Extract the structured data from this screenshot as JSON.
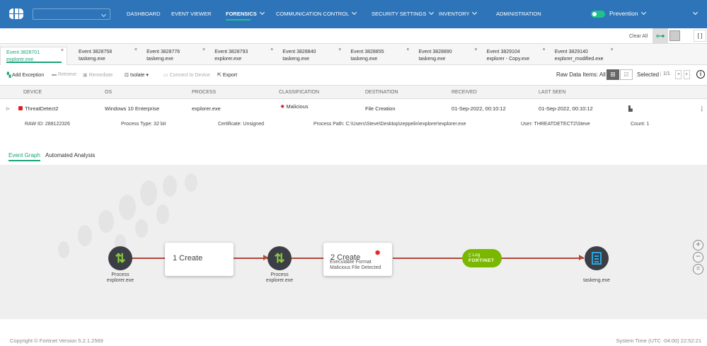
{
  "nav": {
    "items": [
      {
        "label": "DASHBOARD"
      },
      {
        "label": "EVENT VIEWER"
      },
      {
        "label": "FORENSICS",
        "active": true
      },
      {
        "label": "COMMUNICATION CONTROL"
      },
      {
        "label": "SECURITY SETTINGS"
      },
      {
        "label": "INVENTORY"
      },
      {
        "label": "ADMINISTRATION"
      }
    ],
    "mode": "Prevention",
    "mode_on": true,
    "org_select": ""
  },
  "toolbar": {
    "clear_all": "Clear All"
  },
  "tabs": [
    {
      "title": "Event 3828701",
      "sub": "explorer.exe",
      "active": true
    },
    {
      "title": "Event 3828758",
      "sub": "taskeng.exe"
    },
    {
      "title": "Event 3828776",
      "sub": "taskeng.exe"
    },
    {
      "title": "Event 3828793",
      "sub": "explorer.exe"
    },
    {
      "title": "Event 3828840",
      "sub": "taskeng.exe"
    },
    {
      "title": "Event 3828855",
      "sub": "taskeng.exe"
    },
    {
      "title": "Event 3828890",
      "sub": "taskeng.exe"
    },
    {
      "title": "Event 3829104",
      "sub": "explorer - Copy.exe"
    },
    {
      "title": "Event 3829140",
      "sub": "explorer_modified.exe"
    }
  ],
  "actions": {
    "add_exception": "Add Exception",
    "retrieve": "Retrieve",
    "remediate": "Remediate",
    "isolate": "Isolate",
    "connect": "Connect to Device",
    "export": "Export",
    "raw_items": "Raw Data Items: All",
    "selected": "Selected",
    "page": "1/1"
  },
  "table": {
    "headers": [
      "DEVICE",
      "OS",
      "PROCESS",
      "CLASSIFICATION",
      "DESTINATION",
      "RECEIVED",
      "LAST SEEN"
    ],
    "row": {
      "device": "ThreatDetect2",
      "os": "Windows 10 Enterprise",
      "process": "explorer.exe",
      "classification": "Malicious",
      "destination": "File Creation",
      "received": "01-Sep-2022, 00:10:12",
      "last_seen": "01-Sep-2022, 00:10:12"
    },
    "details": {
      "raw_id": "RAW ID: 288122326",
      "process_type": "Process Type: 32 bit",
      "certificate": "Certificate: Unsigned",
      "path": "Process Path: C:\\Users\\Steve\\Desktop\\zeppelin\\explorer\\explorer.exe",
      "user": "User: THREATDETECT2\\Steve",
      "count": "Count: 1"
    }
  },
  "subtabs": {
    "graph": "Event Graph",
    "analysis": "Automated Analysis"
  },
  "graph": {
    "node1": {
      "type": "Process",
      "name": "explorer.exe"
    },
    "box1": "1 Create",
    "node2": {
      "type": "Process",
      "name": "explorer.exe"
    },
    "box2": {
      "title": "2 Create",
      "line1": "Executable Format",
      "line2": "Malicious File Detected"
    },
    "log": {
      "label": "Log",
      "brand": "FORTINET"
    },
    "node3": {
      "name": "taskeng.exe"
    }
  },
  "footer": {
    "copyright": "Copyright © Fortinet Version 5.2.1.2569",
    "time": "System Time (UTC -04:00) 22:52:21"
  },
  "colors": {
    "nav": "#2e74b8",
    "accent": "#1aa37a",
    "malicious": "#e02020",
    "log": "#7ab800"
  }
}
